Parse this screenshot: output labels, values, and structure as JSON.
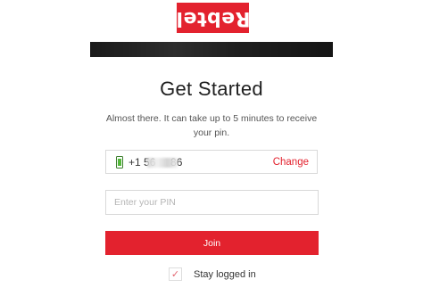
{
  "brand": {
    "logo_text": "Rebtel",
    "accent_color": "#e3222e"
  },
  "header": {
    "title": "Get Started",
    "subtitle": "Almost there. It can take up to 5 minutes to receive your pin."
  },
  "phone": {
    "number_display": "+1 56     86",
    "change_label": "Change",
    "icon": "phone-battery-icon"
  },
  "pin": {
    "placeholder": "Enter your PIN",
    "value": ""
  },
  "join": {
    "label": "Join"
  },
  "stay_logged_in": {
    "label": "Stay logged in",
    "checked": true,
    "check_glyph": "✓"
  }
}
